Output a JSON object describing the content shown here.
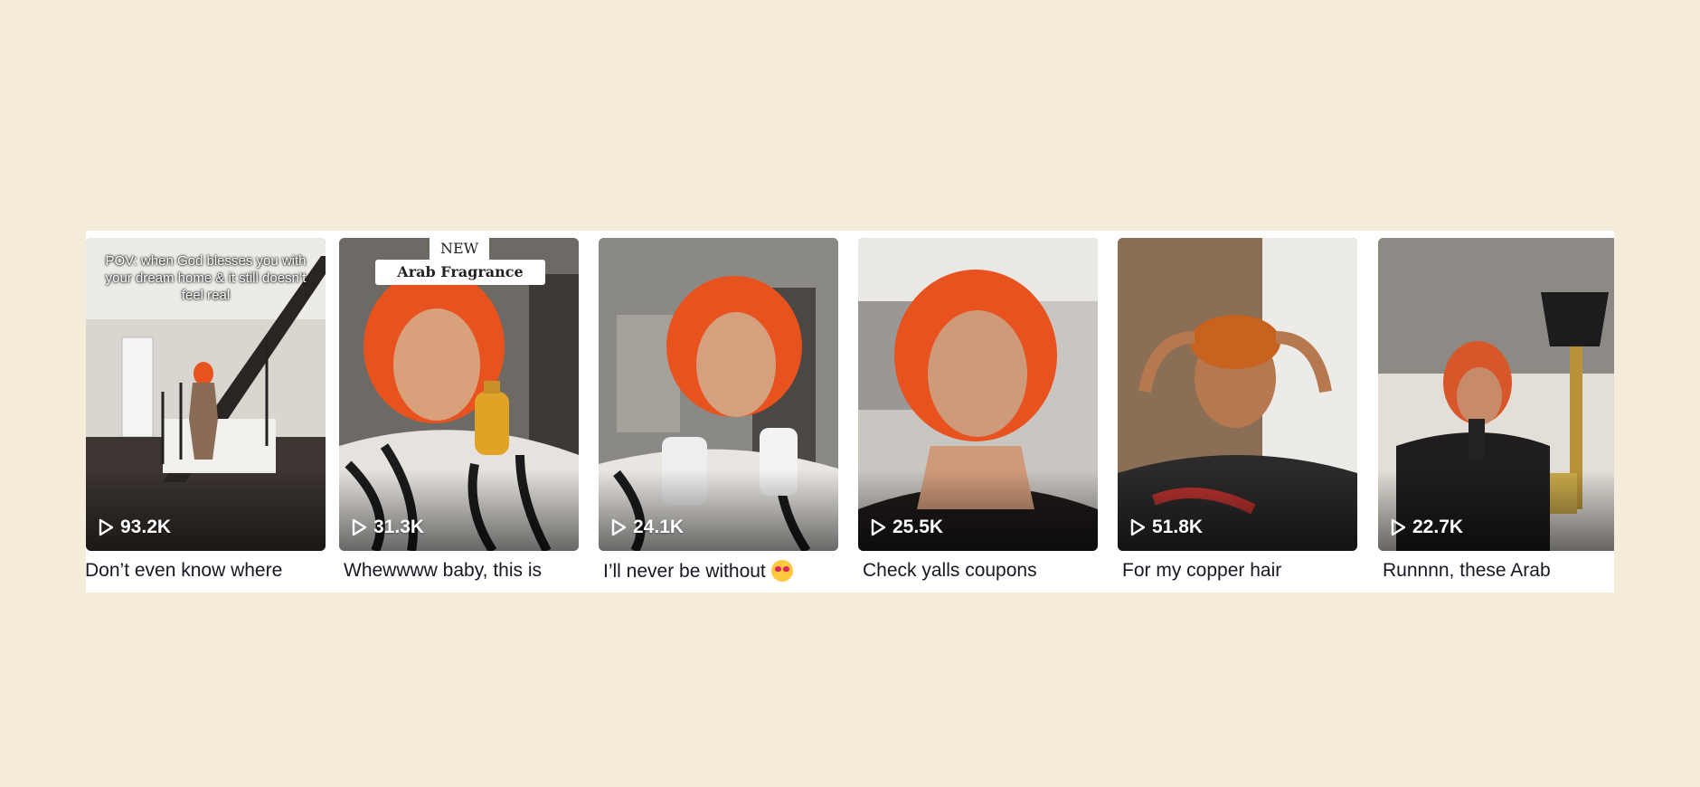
{
  "videos": [
    {
      "views": "93.2K",
      "caption": "Don’t even know where",
      "overlay": "POV: when God blesses you with your dream home & it still doesn’t feel real"
    },
    {
      "views": "31.3K",
      "caption": "Whewwww baby, this is",
      "badge_top": "NEW",
      "badge_main": "Arab Fragrance"
    },
    {
      "views": "24.1K",
      "caption": "I’ll never be without"
    },
    {
      "views": "25.5K",
      "caption": "Check yalls coupons"
    },
    {
      "views": "51.8K",
      "caption": "For my copper hair"
    },
    {
      "views": "22.7K",
      "caption": "Runnnn, these Arab"
    }
  ],
  "icons": {
    "play": "play-icon",
    "emoji": "star-struck-emoji-icon"
  },
  "colors": {
    "page_bg": "#f5edd9",
    "strip_bg": "#ffffff",
    "hair": "#e8521f",
    "caption_text": "#161823"
  }
}
